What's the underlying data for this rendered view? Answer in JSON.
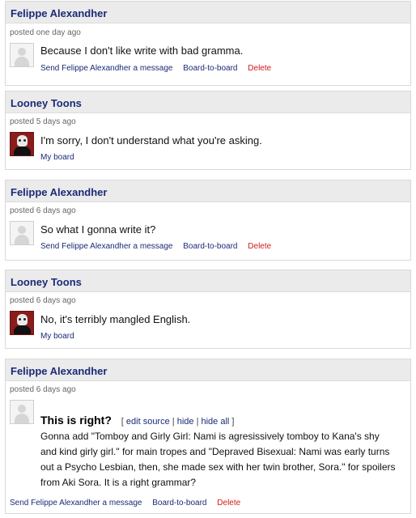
{
  "posts": [
    {
      "author": "Felippe Alexandher",
      "posted": "posted one day ago",
      "message": "Because I don't like write with bad gramma.",
      "actions": [
        "Send Felippe Alexandher a message",
        "Board-to-board",
        "Delete"
      ]
    },
    {
      "author": "Looney Toons",
      "posted": "posted 5 days ago",
      "message": "I'm sorry, I don't understand what you're asking.",
      "actions": [
        "My board"
      ]
    },
    {
      "author": "Felippe Alexandher",
      "posted": "posted 6 days ago",
      "message": "So what I gonna write it?",
      "actions": [
        "Send Felippe Alexandher a message",
        "Board-to-board",
        "Delete"
      ]
    },
    {
      "author": "Looney Toons",
      "posted": "posted 6 days ago",
      "message": "No, it's terribly mangled English.",
      "actions": [
        "My board"
      ]
    },
    {
      "author": "Felippe Alexandher",
      "posted": "posted 6 days ago",
      "heading": "This is right?",
      "tools": {
        "open": "[",
        "edit": "edit source",
        "sep1": "|",
        "hide": "hide",
        "sep2": "|",
        "hide_all": "hide all",
        "close": "]"
      },
      "message": "Gonna add \"Tomboy and Girly Girl: Nami is agresissively tomboy to Kana's shy and kind girly girl.\" for main tropes and \"Depraved Bisexual: Nami was early turns out a Psycho Lesbian, then, she made sex with her twin brother, Sora.\" for spoilers from Aki Sora. It is a right grammar?",
      "actions": [
        "Send Felippe Alexandher a message",
        "Board-to-board",
        "Delete"
      ]
    }
  ]
}
